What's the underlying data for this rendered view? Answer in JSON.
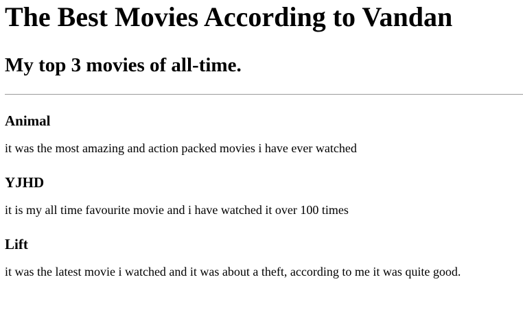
{
  "header": {
    "title": "The Best Movies According to Vandan",
    "subtitle": "My top 3 movies of all-time."
  },
  "movies": [
    {
      "title": "Animal",
      "description": "it was the most amazing and action packed movies i have ever watched"
    },
    {
      "title": "YJHD",
      "description": "it is my all time favourite movie and i have watched it over 100 times"
    },
    {
      "title": "Lift",
      "description": "it was the latest movie i watched and it was about a theft, according to me it was quite good."
    }
  ]
}
